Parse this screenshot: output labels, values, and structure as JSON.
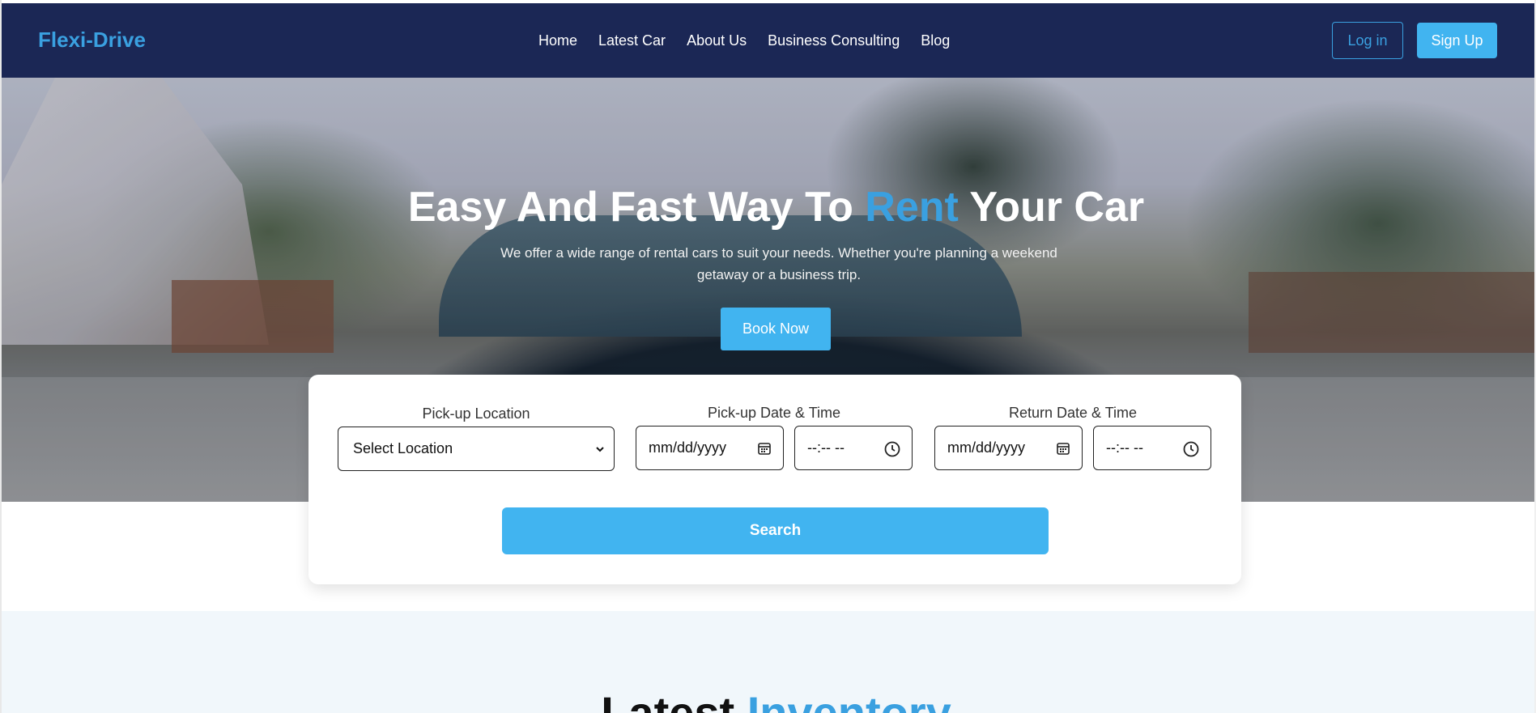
{
  "navbar": {
    "brand": "Flexi-Drive",
    "links": [
      "Home",
      "Latest Car",
      "About Us",
      "Business Consulting",
      "Blog"
    ],
    "login_label": "Log in",
    "signup_label": "Sign Up"
  },
  "hero": {
    "title_part1": "Easy And Fast Way To ",
    "title_accent": "Rent",
    "title_part2": " Your Car",
    "subtitle": "We offer a wide range of rental cars to suit your needs. Whether you're planning a weekend getaway or a business trip.",
    "book_label": "Book Now"
  },
  "search": {
    "pickup_location_label": "Pick-up Location",
    "pickup_location_value": "Select Location",
    "pickup_datetime_label": "Pick-up Date & Time",
    "pickup_date_placeholder": "mm/dd/yyyy",
    "pickup_time_placeholder": "--:-- --",
    "return_datetime_label": "Return Date & Time",
    "return_date_placeholder": "mm/dd/yyyy",
    "return_time_placeholder": "--:-- --",
    "search_label": "Search"
  },
  "inventory": {
    "title_part1": "Latest ",
    "title_accent": "Inventory"
  },
  "colors": {
    "navbar_bg": "#1b2755",
    "accent": "#3aa0e0",
    "button": "#41b4f0",
    "section_bg": "#f1f7fb"
  }
}
